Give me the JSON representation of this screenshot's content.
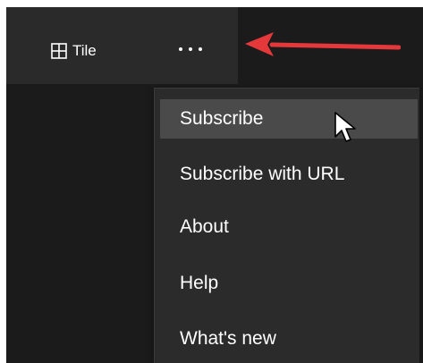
{
  "toolbar": {
    "tile_label": "Tile",
    "tile_icon": "grid-icon",
    "more_icon": "ellipsis-icon"
  },
  "menu": {
    "items": [
      {
        "label": "Subscribe",
        "hovered": true
      },
      {
        "label": "Subscribe with URL",
        "hovered": false
      },
      {
        "label": "About",
        "hovered": false
      },
      {
        "label": "Help",
        "hovered": false
      },
      {
        "label": "What's new",
        "hovered": false
      }
    ]
  },
  "annotation": {
    "arrow_icon": "red-arrow-icon",
    "arrow_color": "#e5383b"
  },
  "colors": {
    "window_bg": "#1b1b1b",
    "toolbar_bg": "#2a2a2a",
    "menu_bg": "#2b2b2b",
    "menu_hover_bg": "#4a4a4a",
    "text": "#ffffff"
  }
}
